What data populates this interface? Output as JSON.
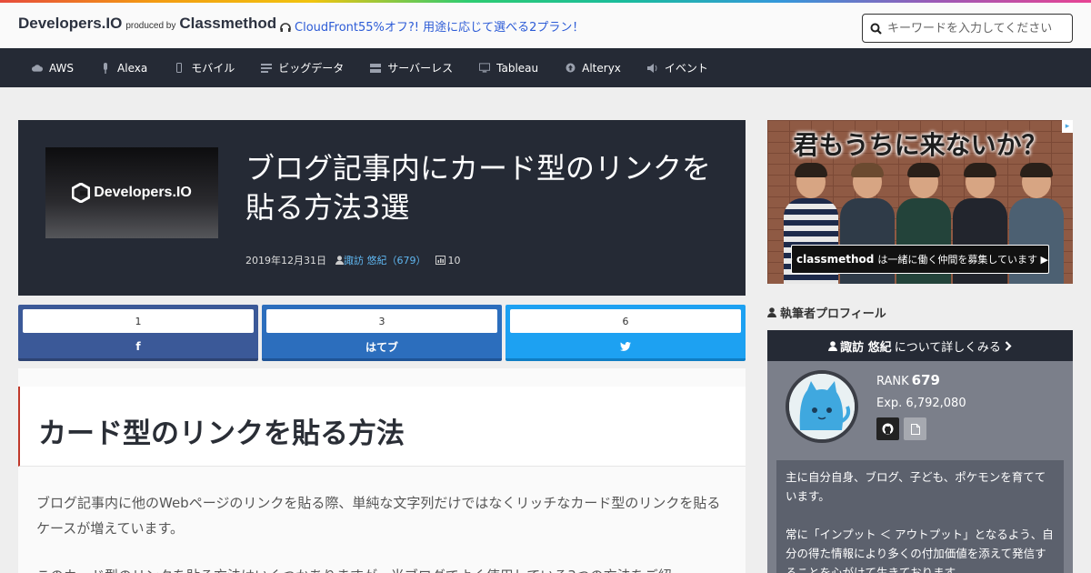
{
  "header": {
    "logo": "Developers.IO",
    "produced_by": "produced by",
    "company": "Classmethod",
    "promo": "CloudFront55%オフ?! 用途に応じて選べる2プラン！",
    "search_placeholder": "キーワードを入力してください"
  },
  "nav": {
    "items": [
      {
        "label": "AWS",
        "icon": "cloud-icon"
      },
      {
        "label": "Alexa",
        "icon": "microphone-icon"
      },
      {
        "label": "モバイル",
        "icon": "mobile-icon"
      },
      {
        "label": "ビッグデータ",
        "icon": "list-icon"
      },
      {
        "label": "サーバーレス",
        "icon": "server-icon"
      },
      {
        "label": "Tableau",
        "icon": "monitor-icon"
      },
      {
        "label": "Alteryx",
        "icon": "circle-arrow-icon"
      },
      {
        "label": "イベント",
        "icon": "speaker-icon"
      }
    ]
  },
  "article": {
    "thumb_logo": "Developers.IO",
    "title": "ブログ記事内にカード型のリンクを貼る方法3選",
    "date": "2019年12月31日",
    "author": "諏訪 悠紀（679）",
    "views": "10",
    "section_heading": "カード型のリンクを貼る方法",
    "paragraph1": "ブログ記事内に他のWebページのリンクを貼る際、単純な文字列だけではなくリッチなカード型のリンクを貼るケースが増えています。",
    "paragraph2": "このカード型のリンクを貼る方法はいくつかありますが、当ブログでよく使用している3つの方法をご紹"
  },
  "shares": [
    {
      "count": "1",
      "label": "f",
      "color": "#3b5998"
    },
    {
      "count": "3",
      "label": "はてブ",
      "color": "#2c6ebd"
    },
    {
      "count": "6",
      "label": "",
      "color": "#1da1f2"
    }
  ],
  "ad": {
    "headline": "君もうちに来ないか？",
    "brand": "classmethod",
    "tagline": "は一緒に働く仲間を募集しています ▶"
  },
  "profile": {
    "heading": "執筆者プロフィール",
    "name": "諏訪 悠紀",
    "details_link": "について詳しくみる",
    "rank_label": "RANK",
    "rank_value": "679",
    "exp": "Exp. 6,792,080",
    "bio_line1": "主に自分自身、ブログ、子ども、ポケモンを育てています。",
    "bio_line2": "常に「インプット ＜ アウトプット」となるよう、自分の得た情報により多くの付加価値を添えて発信することを心がけて生きております。"
  }
}
